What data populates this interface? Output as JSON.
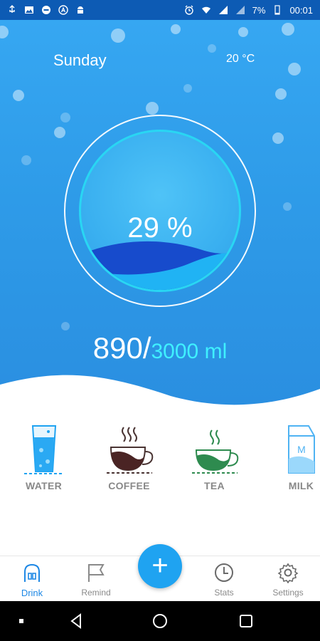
{
  "status_bar": {
    "battery": "7%",
    "time": "00:01",
    "left_icons": [
      "usb-icon",
      "image-icon",
      "minus-circle-icon",
      "a-circle-icon",
      "android-icon"
    ],
    "right_icons": [
      "alarm-icon",
      "wifi-icon",
      "signal-icon",
      "battery-icon"
    ]
  },
  "header": {
    "day": "Sunday",
    "temperature": "20 °C"
  },
  "progress": {
    "percent_text": "29 %",
    "fraction": 0.29
  },
  "intake": {
    "current": "890/",
    "total": "3000 ml"
  },
  "drinks": [
    {
      "label": "WATER",
      "icon": "water-glass-icon"
    },
    {
      "label": "COFFEE",
      "icon": "coffee-cup-icon"
    },
    {
      "label": "TEA",
      "icon": "tea-cup-icon"
    },
    {
      "label": "MILK",
      "icon": "milk-carton-icon"
    }
  ],
  "nav": {
    "items": [
      {
        "label": "Drink",
        "icon": "drink-icon",
        "active": true
      },
      {
        "label": "Remind",
        "icon": "flag-icon",
        "active": false
      },
      {
        "label": "Stats",
        "icon": "clock-icon",
        "active": false
      },
      {
        "label": "Settings",
        "icon": "gear-icon",
        "active": false
      }
    ],
    "fab_symbol": "+"
  },
  "colors": {
    "accent": "#1fa3f1",
    "active_nav": "#1e88e5",
    "label_gray": "#888888",
    "wave_dark": "#1546c9"
  }
}
